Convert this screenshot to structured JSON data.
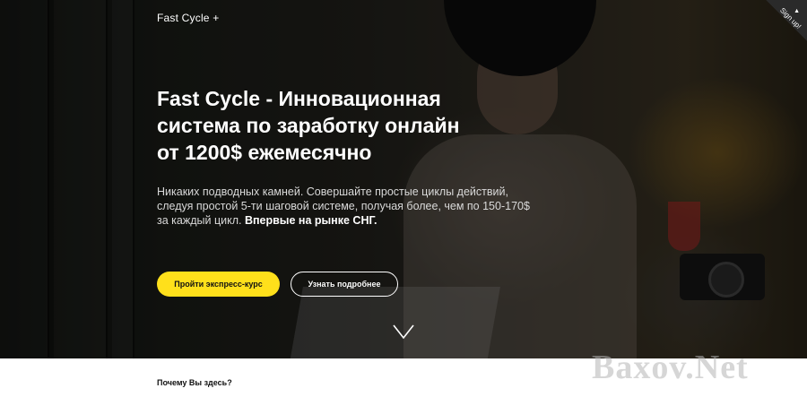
{
  "header": {
    "logo": "Fast Cycle +",
    "ribbon_label": "Sign up!"
  },
  "hero": {
    "headline_line1": "Fast Cycle - Инновационная",
    "headline_line2": "система по заработку онлайн",
    "headline_line3": "от 1200$ ежемесячно",
    "description": "Никаких подводных камней. Совершайте простые циклы действий, следуя простой 5-ти шаговой системе, получая более, чем по 150-170$ за каждый цикл.",
    "description_bold": "Впервые на рынке СНГ.",
    "primary_button": "Пройти экспресс-курс",
    "secondary_button": "Узнать подробнее",
    "scroll_icon": "chevron-down-icon"
  },
  "section": {
    "title": "Почему Вы здесь?"
  },
  "watermark": "Baxov.Net",
  "colors": {
    "accent": "#ffe01b",
    "hero_text": "#ffffff"
  }
}
